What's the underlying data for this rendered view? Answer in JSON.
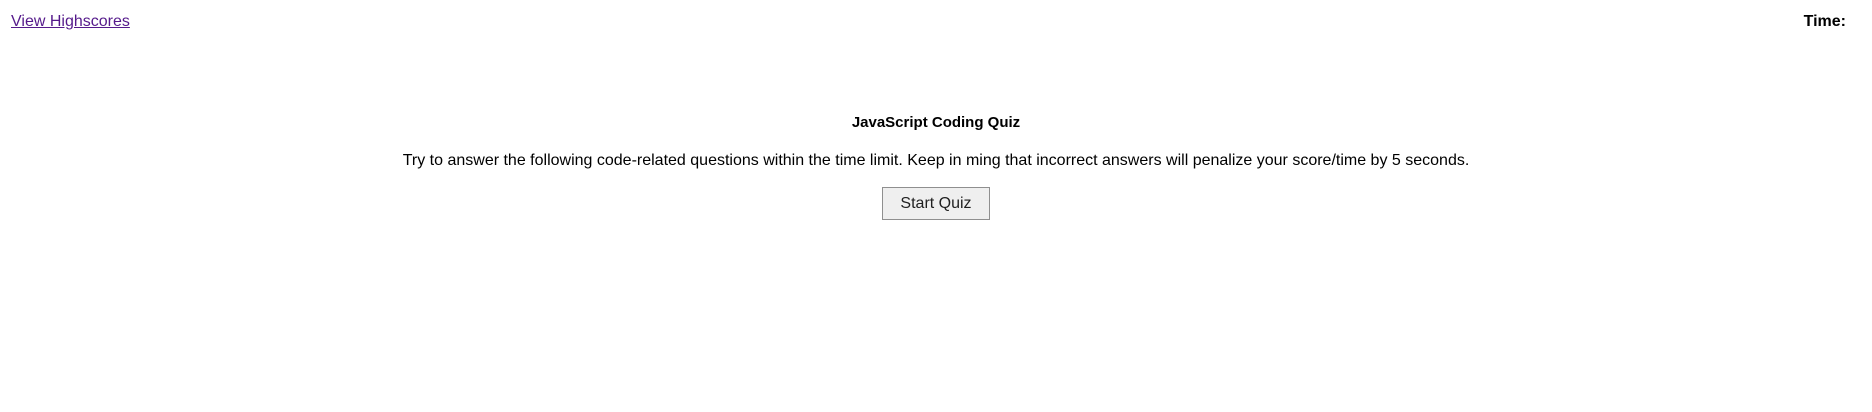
{
  "header": {
    "highscores_link": "View Highscores",
    "timer_label": "Time:",
    "timer_value": ""
  },
  "main": {
    "title": "JavaScript Coding Quiz",
    "description": "Try to answer the following code-related questions within the time limit. Keep in ming that incorrect answers will penalize your score/time by 5 seconds.",
    "start_button": "Start Quiz"
  },
  "colors": {
    "link": "#551a8b",
    "button_bg": "#efefef",
    "button_border": "#8f8f8f",
    "text": "#000000"
  }
}
